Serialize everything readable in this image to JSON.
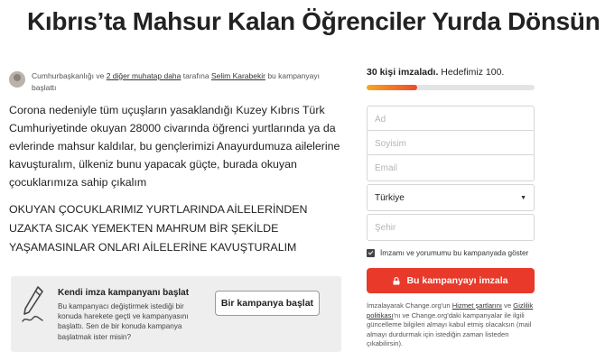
{
  "page": {
    "title": "Kıbrıs’ta Mahsur Kalan Öğrenciler Yurda Dönsün"
  },
  "meta": {
    "part1": "Cumhurbaşkanlığı ve ",
    "decision_makers_link": "2 diğer muhatap daha",
    "part2": " tarafına ",
    "starter_link": "Selim Karabekir",
    "part3": " bu kampanyayı başlattı"
  },
  "description": "Corona nedeniyle tüm uçuşların yasaklandığı Kuzey Kıbrıs Türk Cumhuriyetinde okuyan 28000 civarında öğrenci yurtlarında ya da evlerinde mahsur kaldılar, bu gençlerimizi Anayurdumuza ailelerine kavuşturalım, ülkeniz bunu yapacak güçte, burada okuyan çocuklarımıza sahip çıkalım",
  "caps_text": "OKUYAN ÇOCUKLARIMIZ YURTLARINDA AİLELERİNDEN UZAKTA SICAK YEMEKTEN MAHRUM BİR ŞEKİLDE YAŞAMASINLAR ONLARI AİLELERİNE KAVUŞTURALIM",
  "start_campaign": {
    "icon": "pen-icon",
    "title": "Kendi imza kampanyanı başlat",
    "description": "Bu kampanyacı değiştirmek istediği bir konuda harekete geçti ve kampanyasını başlattı. Sen de bir konuda kampanya başlatmak ister misin?",
    "button_label": "Bir kampanya başlat"
  },
  "progress": {
    "signed_count_text": "30 kişi imzaladı.",
    "goal_text": " Hedefimiz 100.",
    "signed": 30,
    "goal": 100,
    "colors": {
      "start": "#f6a623",
      "end": "#ee4b2b"
    }
  },
  "form": {
    "first_name_placeholder": "Ad",
    "last_name_placeholder": "Soyisim",
    "email_placeholder": "Email",
    "country_value": "Türkiye",
    "city_placeholder": "Şehir",
    "consent_label": "İmzamı ve yorumumu bu kampanyada göster",
    "consent_checked": true,
    "sign_button_label": "Bu kampanyayı imzala",
    "sign_button_color": "#e8392a"
  },
  "legal": {
    "part1": "İmzalayarak Change.org'un ",
    "terms_link": "Hizmet şartlarını",
    "part2": " ve ",
    "privacy_link": "Gizlilik politikası",
    "part3": "'nı ve Change.org'daki kampanyalar ile ilgili güncelleme bilgileri almayı kabul etmiş olacaksın (mail almayı durdurmak için istediğin zaman listeden çıkabilirsin)."
  }
}
